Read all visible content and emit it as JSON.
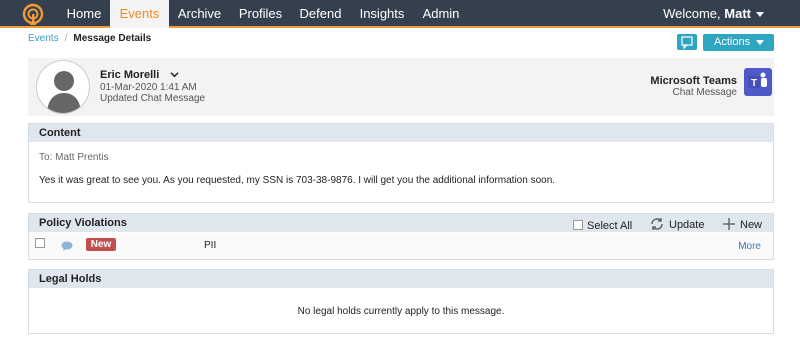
{
  "nav": {
    "items": [
      {
        "label": "Home",
        "active": false
      },
      {
        "label": "Events",
        "active": true
      },
      {
        "label": "Archive",
        "active": false
      },
      {
        "label": "Profiles",
        "active": false
      },
      {
        "label": "Defend",
        "active": false
      },
      {
        "label": "Insights",
        "active": false
      },
      {
        "label": "Admin",
        "active": false
      }
    ],
    "welcome_prefix": "Welcome,",
    "user": "Matt"
  },
  "breadcrumb": {
    "parent": "Events",
    "separator": "/",
    "current": "Message Details"
  },
  "toolbar": {
    "actions_label": "Actions"
  },
  "message": {
    "sender": "Eric Morelli",
    "date": "01-Mar-2020 1:41 AM",
    "type": "Updated Chat Message",
    "source_name": "Microsoft Teams",
    "source_sub": "Chat Message"
  },
  "content": {
    "heading": "Content",
    "to_line": "To: Matt Prentis",
    "body": "Yes it was great to see you. As you requested, my SSN is 703-38-9876. I will get you the additional information soon."
  },
  "policy_violations": {
    "heading": "Policy Violations",
    "select_all": "Select All",
    "update": "Update",
    "new": "New",
    "rows": [
      {
        "badge": "New",
        "policy": "PII",
        "more": "More"
      }
    ]
  },
  "legal_holds": {
    "heading": "Legal Holds",
    "empty_message": "No legal holds currently apply to this message."
  },
  "colors": {
    "nav_bg": "#34404e",
    "accent_orange": "#f29a38",
    "button_teal": "#2fa6c1",
    "panel_header": "#dfe6ee",
    "badge_red": "#c0504d",
    "teams_purple": "#5059c9"
  }
}
